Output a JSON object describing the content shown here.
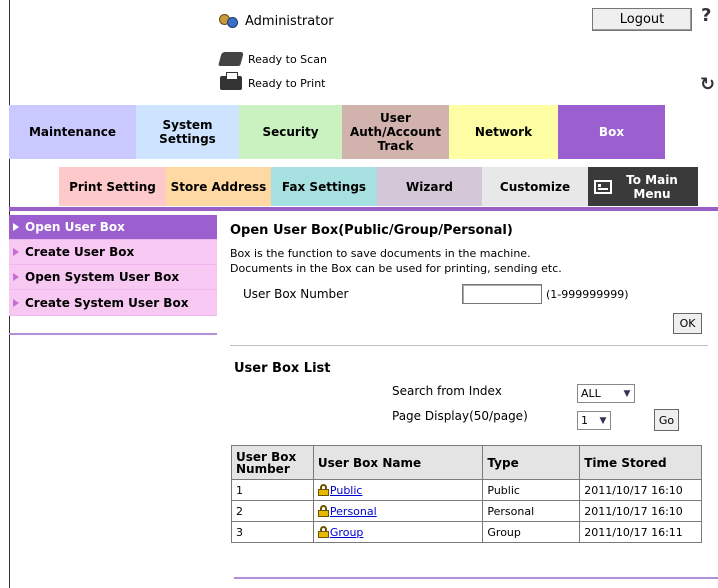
{
  "header": {
    "user": "Administrator",
    "logout_label": "Logout",
    "help_glyph": "?",
    "refresh_glyph": "↻",
    "status": [
      {
        "text": "Ready to Scan",
        "icon": "scanner-icon"
      },
      {
        "text": "Ready to Print",
        "icon": "printer-icon"
      }
    ]
  },
  "main_tabs": [
    {
      "label": "Maintenance",
      "color": "#c9c9ff"
    },
    {
      "label": "System Settings",
      "color": "#cde3ff"
    },
    {
      "label": "Security",
      "color": "#c9f2c0"
    },
    {
      "label": "User Auth/Account Track",
      "color": "#d2b2ac"
    },
    {
      "label": "Network",
      "color": "#fdfda4"
    },
    {
      "label": "Box",
      "color": "#9b5fd0",
      "active": true
    }
  ],
  "sub_tabs": [
    {
      "label": "Print Setting",
      "color": "#fdc9cb"
    },
    {
      "label": "Store Address",
      "color": "#ffd9a4"
    },
    {
      "label": "Fax Settings",
      "color": "#a7e0e0"
    },
    {
      "label": "Wizard",
      "color": "#d4c7d8"
    },
    {
      "label": "Customize",
      "color": "#e8e8e8"
    },
    {
      "label": "To Main Menu",
      "color": "#3a3a3a"
    }
  ],
  "left_nav": [
    {
      "label": "Open User Box",
      "active": true
    },
    {
      "label": "Create User Box"
    },
    {
      "label": "Open System User Box"
    },
    {
      "label": "Create System User Box"
    }
  ],
  "open_box": {
    "title": "Open User Box(Public/Group/Personal)",
    "desc1": "Box is the function to save documents in the machine.",
    "desc2": "Documents in the Box can be used for printing, sending etc.",
    "number_label": "User Box Number",
    "number_value": "",
    "number_range": "(1-999999999)",
    "ok_label": "OK"
  },
  "box_list": {
    "title": "User Box List",
    "search_label": "Search from Index",
    "search_value": "ALL",
    "page_label": "Page Display(50/page)",
    "page_value": "1",
    "go_label": "Go",
    "columns": [
      "User Box Number",
      "User Box Name",
      "Type",
      "Time Stored"
    ],
    "rows": [
      {
        "number": "1",
        "name": "Public",
        "type": "Public",
        "time": "2011/10/17 16:10"
      },
      {
        "number": "2",
        "name": "Personal",
        "type": "Personal",
        "time": "2011/10/17 16:10"
      },
      {
        "number": "3",
        "name": "Group",
        "type": "Group",
        "time": "2011/10/17 16:11"
      }
    ]
  }
}
